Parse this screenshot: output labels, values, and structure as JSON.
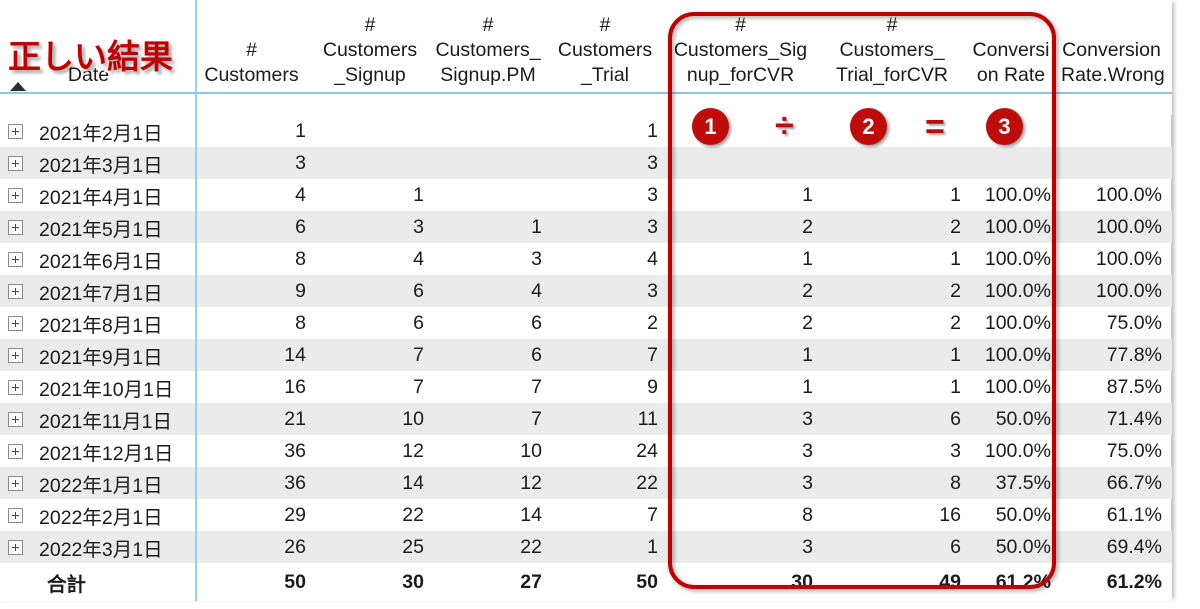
{
  "annotation": {
    "stamp_text": "正しい結果",
    "accent_color": "#c00000",
    "badges": [
      {
        "label": "1"
      },
      {
        "label": "2"
      },
      {
        "label": "3"
      }
    ],
    "operators": [
      {
        "symbol": "÷",
        "name": "divide"
      },
      {
        "symbol": "=",
        "name": "equals"
      }
    ]
  },
  "table": {
    "columns": [
      {
        "key": "date",
        "label": "Date",
        "align": "left"
      },
      {
        "key": "customers",
        "label": "#\nCustomers",
        "align": "right"
      },
      {
        "key": "signup",
        "label": "#\nCustomers\n_Signup",
        "align": "right"
      },
      {
        "key": "signup_pm",
        "label": "#\nCustomers_\nSignup.PM",
        "align": "right"
      },
      {
        "key": "trial",
        "label": "#\nCustomers\n_Trial",
        "align": "right"
      },
      {
        "key": "signup_forcvr",
        "label": "#\nCustomers_Sig\nnup_forCVR",
        "align": "right"
      },
      {
        "key": "trial_forcvr",
        "label": "#\nCustomers_\nTrial_forCVR",
        "align": "right"
      },
      {
        "key": "cvr",
        "label": "Conversi\non Rate",
        "align": "right"
      },
      {
        "key": "cvr_wrong",
        "label": "Conversion\nRate.Wrong",
        "align": "right"
      }
    ],
    "sort_indicator": "ascending",
    "expand_icon": "plus-box-icon",
    "rows": [
      {
        "date": "2021年2月1日",
        "customers": "1",
        "signup": "",
        "signup_pm": "",
        "trial": "1",
        "signup_forcvr": "",
        "trial_forcvr": "",
        "cvr": "",
        "cvr_wrong": ""
      },
      {
        "date": "2021年3月1日",
        "customers": "3",
        "signup": "",
        "signup_pm": "",
        "trial": "3",
        "signup_forcvr": "",
        "trial_forcvr": "",
        "cvr": "",
        "cvr_wrong": ""
      },
      {
        "date": "2021年4月1日",
        "customers": "4",
        "signup": "1",
        "signup_pm": "",
        "trial": "3",
        "signup_forcvr": "1",
        "trial_forcvr": "1",
        "cvr": "100.0%",
        "cvr_wrong": "100.0%"
      },
      {
        "date": "2021年5月1日",
        "customers": "6",
        "signup": "3",
        "signup_pm": "1",
        "trial": "3",
        "signup_forcvr": "2",
        "trial_forcvr": "2",
        "cvr": "100.0%",
        "cvr_wrong": "100.0%"
      },
      {
        "date": "2021年6月1日",
        "customers": "8",
        "signup": "4",
        "signup_pm": "3",
        "trial": "4",
        "signup_forcvr": "1",
        "trial_forcvr": "1",
        "cvr": "100.0%",
        "cvr_wrong": "100.0%"
      },
      {
        "date": "2021年7月1日",
        "customers": "9",
        "signup": "6",
        "signup_pm": "4",
        "trial": "3",
        "signup_forcvr": "2",
        "trial_forcvr": "2",
        "cvr": "100.0%",
        "cvr_wrong": "100.0%"
      },
      {
        "date": "2021年8月1日",
        "customers": "8",
        "signup": "6",
        "signup_pm": "6",
        "trial": "2",
        "signup_forcvr": "2",
        "trial_forcvr": "2",
        "cvr": "100.0%",
        "cvr_wrong": "75.0%"
      },
      {
        "date": "2021年9月1日",
        "customers": "14",
        "signup": "7",
        "signup_pm": "6",
        "trial": "7",
        "signup_forcvr": "1",
        "trial_forcvr": "1",
        "cvr": "100.0%",
        "cvr_wrong": "77.8%"
      },
      {
        "date": "2021年10月1日",
        "customers": "16",
        "signup": "7",
        "signup_pm": "7",
        "trial": "9",
        "signup_forcvr": "1",
        "trial_forcvr": "1",
        "cvr": "100.0%",
        "cvr_wrong": "87.5%"
      },
      {
        "date": "2021年11月1日",
        "customers": "21",
        "signup": "10",
        "signup_pm": "7",
        "trial": "11",
        "signup_forcvr": "3",
        "trial_forcvr": "6",
        "cvr": "50.0%",
        "cvr_wrong": "71.4%"
      },
      {
        "date": "2021年12月1日",
        "customers": "36",
        "signup": "12",
        "signup_pm": "10",
        "trial": "24",
        "signup_forcvr": "3",
        "trial_forcvr": "3",
        "cvr": "100.0%",
        "cvr_wrong": "75.0%"
      },
      {
        "date": "2022年1月1日",
        "customers": "36",
        "signup": "14",
        "signup_pm": "12",
        "trial": "22",
        "signup_forcvr": "3",
        "trial_forcvr": "8",
        "cvr": "37.5%",
        "cvr_wrong": "66.7%"
      },
      {
        "date": "2022年2月1日",
        "customers": "29",
        "signup": "22",
        "signup_pm": "14",
        "trial": "7",
        "signup_forcvr": "8",
        "trial_forcvr": "16",
        "cvr": "50.0%",
        "cvr_wrong": "61.1%"
      },
      {
        "date": "2022年3月1日",
        "customers": "26",
        "signup": "25",
        "signup_pm": "22",
        "trial": "1",
        "signup_forcvr": "3",
        "trial_forcvr": "6",
        "cvr": "50.0%",
        "cvr_wrong": "69.4%"
      }
    ],
    "total_row": {
      "date": "合計",
      "customers": "50",
      "signup": "30",
      "signup_pm": "27",
      "trial": "50",
      "signup_forcvr": "30",
      "trial_forcvr": "49",
      "cvr": "61.2%",
      "cvr_wrong": "61.2%"
    }
  }
}
